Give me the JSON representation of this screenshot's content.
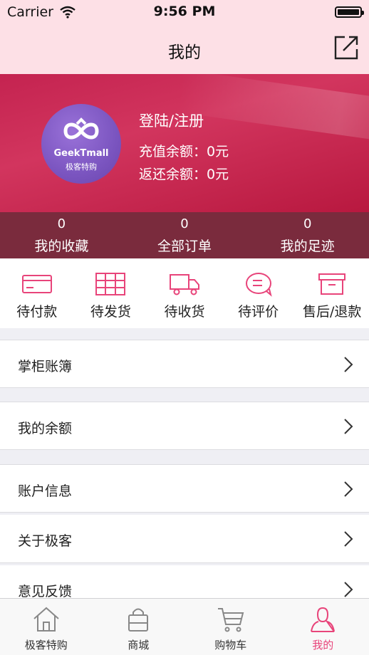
{
  "status_bar": {
    "carrier": "Carrier",
    "time": "9:56 PM"
  },
  "nav": {
    "title": "我的"
  },
  "profile": {
    "brand": "GeekTmall",
    "brand_sub": "极客特购",
    "login_label": "登陆/注册",
    "recharge_balance": "充值余额：0元",
    "refund_balance": "返还余额：0元"
  },
  "stats": [
    {
      "count": "0",
      "label": "我的收藏"
    },
    {
      "count": "0",
      "label": "全部订单"
    },
    {
      "count": "0",
      "label": "我的足迹"
    }
  ],
  "orders": [
    {
      "label": "待付款",
      "icon": "card-icon"
    },
    {
      "label": "待发货",
      "icon": "package-grid-icon"
    },
    {
      "label": "待收货",
      "icon": "truck-icon"
    },
    {
      "label": "待评价",
      "icon": "chat-icon"
    },
    {
      "label": "售后/退款",
      "icon": "return-box-icon"
    }
  ],
  "menu": [
    {
      "label": "掌柜账簿"
    },
    {
      "label": "我的余额"
    },
    {
      "label": "账户信息"
    },
    {
      "label": "关于极客"
    },
    {
      "label": "意见反馈"
    }
  ],
  "tabs": [
    {
      "label": "极客特购",
      "icon": "home-icon"
    },
    {
      "label": "商城",
      "icon": "shopping-bag-icon"
    },
    {
      "label": "购物车",
      "icon": "cart-icon"
    },
    {
      "label": "我的",
      "icon": "user-icon",
      "active": true
    }
  ],
  "colors": {
    "accent": "#e8447a",
    "header_pink": "#fde0e6",
    "profile_red": "#c42350",
    "stats_bg": "#7a2b3d"
  }
}
